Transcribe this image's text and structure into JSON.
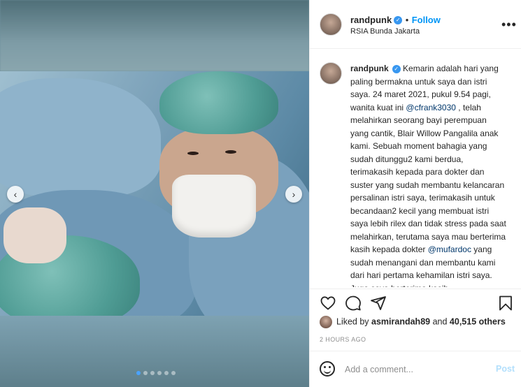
{
  "post": {
    "username": "randpunk",
    "follow_label": "Follow",
    "location": "RSIA Bunda Jakarta",
    "verified_mark": "✓",
    "more_label": "•••"
  },
  "caption": {
    "username": "randpunk",
    "text_1": "Kemarin adalah hari yang paling bermakna untuk saya dan istri saya. 24 maret 2021, pukul 9.54 pagi, wanita kuat ini ",
    "mention_1": "@cfrank3030",
    "text_2": " , telah melahirkan seorang bayi perempuan yang cantik, Blair Willow Pangalila anak kami. Sebuah moment bahagia yang sudah ditunggu2 kami berdua, terimakasih kepada para dokter dan suster yang sudah membantu kelancaran persalinan istri saya, terimakasih untuk becandaan2 kecil yang membuat istri saya lebih rilex dan tidak stress pada saat melahirkan, terutama saya mau berterima kasih kepada dokter ",
    "mention_2": "@mufardoc",
    "text_3": " yang sudah menangani dan membantu kami dari hari pertama kehamilan istri saya. Juga saya berterima kasih"
  },
  "likes": {
    "prefix": "Liked by ",
    "user": "asmirandah89",
    "middle": " and ",
    "count": "40,515 others"
  },
  "timestamp": "2 HOURS AGO",
  "comment": {
    "placeholder": "Add a comment...",
    "post_label": "Post"
  },
  "carousel": {
    "prev_label": "‹",
    "next_label": "›",
    "slide_count": 6,
    "active_index": 0
  },
  "icons": {
    "like": "heart-icon",
    "comment": "comment-icon",
    "share": "share-icon",
    "save": "bookmark-icon",
    "emoji": "emoji-icon"
  },
  "colors": {
    "link": "#0095f6",
    "mention": "#00376b",
    "verified": "#3897f0",
    "post_disabled": "#b2dffc"
  }
}
